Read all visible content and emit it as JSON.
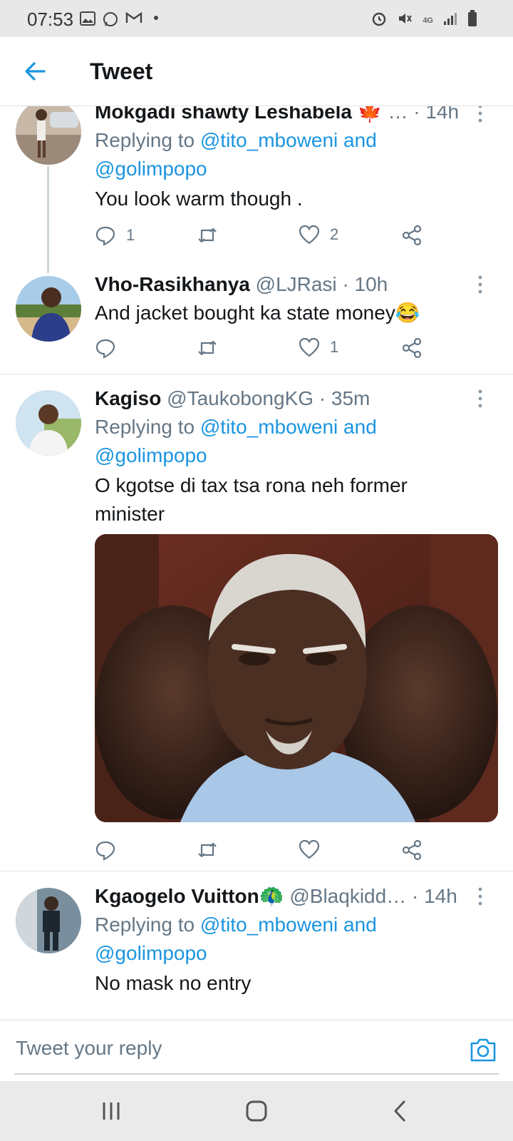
{
  "status_bar": {
    "time": "07:53",
    "network": "4G"
  },
  "header": {
    "title": "Tweet"
  },
  "tweets": [
    {
      "name": "Mokgadi shawty Leshabela",
      "name_emoji": "🍁",
      "handle": "…",
      "time": "· 14h",
      "replying_prefix": "Replying to ",
      "replying_to": "@tito_mboweni and",
      "replying_to_2": "@golimpopo",
      "text": "You look warm though .",
      "reply_count": "1",
      "retweet_count": "",
      "like_count": "2"
    },
    {
      "name": "Vho-Rasikhanya",
      "handle": "@LJRasi",
      "time": "· 10h",
      "text": "And jacket bought ka state money😂",
      "reply_count": "",
      "retweet_count": "",
      "like_count": "1"
    },
    {
      "name": "Kagiso",
      "handle": "@TaukobongKG",
      "time": "· 35m",
      "replying_prefix": "Replying to ",
      "replying_to": "@tito_mboweni and",
      "replying_to_2": "@golimpopo",
      "text": "O kgotse di tax tsa rona neh former minister",
      "reply_count": "",
      "retweet_count": "",
      "like_count": ""
    },
    {
      "name": "Kgaogelo Vuitton🦚",
      "handle": "@Blaqkidd…",
      "time": "· 14h",
      "replying_prefix": "Replying to ",
      "replying_to": "@tito_mboweni and",
      "replying_to_2": "@golimpopo",
      "text": "No mask no entry"
    }
  ],
  "reply_bar": {
    "placeholder": "Tweet your reply"
  },
  "colors": {
    "accent": "#1b95e0",
    "muted": "#657786",
    "text": "#14171a"
  }
}
